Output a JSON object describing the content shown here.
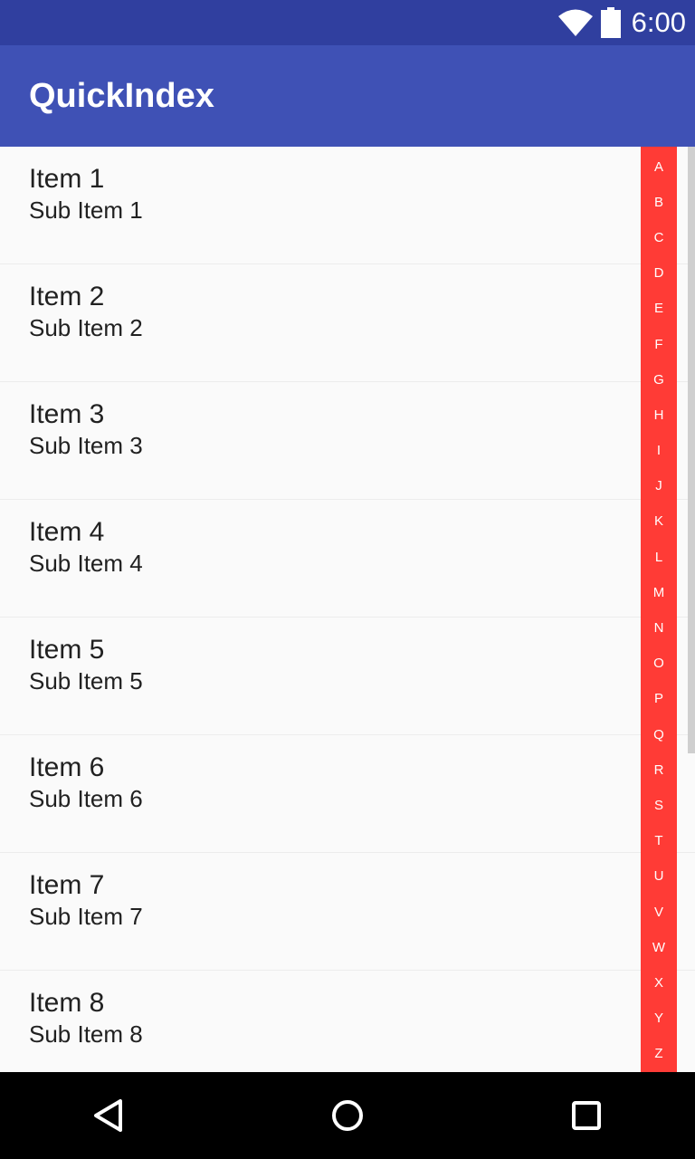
{
  "status_bar": {
    "time": "6:00",
    "icons": [
      "wifi-icon",
      "battery-icon"
    ]
  },
  "app_bar": {
    "title": "QuickIndex"
  },
  "list": {
    "items": [
      {
        "title": "Item 1",
        "subtitle": "Sub Item 1"
      },
      {
        "title": "Item 2",
        "subtitle": "Sub Item 2"
      },
      {
        "title": "Item 3",
        "subtitle": "Sub Item 3"
      },
      {
        "title": "Item 4",
        "subtitle": "Sub Item 4"
      },
      {
        "title": "Item 5",
        "subtitle": "Sub Item 5"
      },
      {
        "title": "Item 6",
        "subtitle": "Sub Item 6"
      },
      {
        "title": "Item 7",
        "subtitle": "Sub Item 7"
      },
      {
        "title": "Item 8",
        "subtitle": "Sub Item 8"
      }
    ]
  },
  "index_bar": {
    "letters": [
      "A",
      "B",
      "C",
      "D",
      "E",
      "F",
      "G",
      "H",
      "I",
      "J",
      "K",
      "L",
      "M",
      "N",
      "O",
      "P",
      "Q",
      "R",
      "S",
      "T",
      "U",
      "V",
      "W",
      "X",
      "Y",
      "Z"
    ]
  },
  "nav_bar": {
    "buttons": [
      "back-icon",
      "home-icon",
      "recents-icon"
    ]
  },
  "colors": {
    "status_bar": "#303f9f",
    "app_bar": "#3f51b5",
    "index_bar": "#ff3b36",
    "background": "#fafafa",
    "nav_bar": "#000000"
  }
}
